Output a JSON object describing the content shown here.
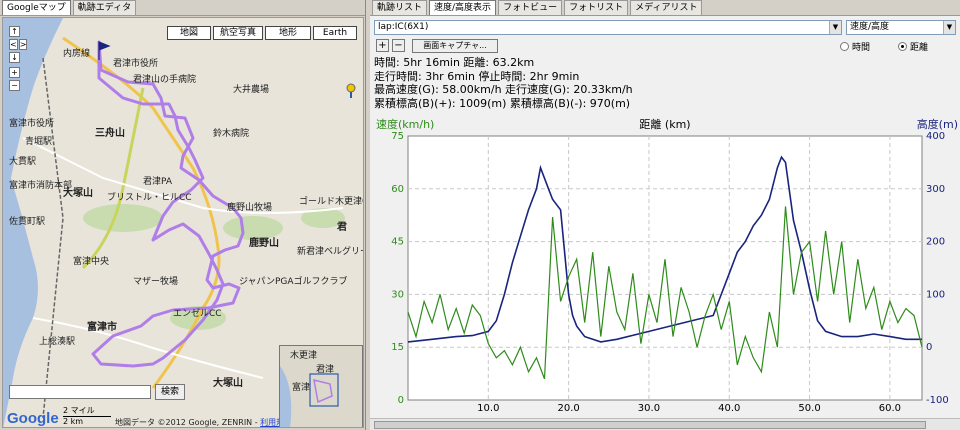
{
  "left_tabs": [
    "Googleマップ",
    "軌跡エディタ"
  ],
  "map": {
    "types": [
      "地図",
      "航空写真",
      "地形",
      "Earth"
    ],
    "labels": [
      {
        "text": "君津市役所"
      },
      {
        "text": "君津山の手病院"
      },
      {
        "text": "大井農場"
      },
      {
        "text": "鈴木病院"
      },
      {
        "text": "富津市役所"
      },
      {
        "text": "三舟山"
      },
      {
        "text": "大塚山"
      },
      {
        "text": "富津市消防本部"
      },
      {
        "text": "ブリストル・ヒルCC"
      },
      {
        "text": "君津PA"
      },
      {
        "text": "鹿野山牧場"
      },
      {
        "text": "鹿野山"
      },
      {
        "text": "ゴールド木更津CC"
      },
      {
        "text": "新君津ベルグリーンCC"
      },
      {
        "text": "マザー牧場"
      },
      {
        "text": "ジャパンPGAゴルフクラブ"
      },
      {
        "text": "エンゼルCC"
      },
      {
        "text": "富津市"
      },
      {
        "text": "上総湊駅"
      },
      {
        "text": "大塚山"
      },
      {
        "text": "内房線"
      },
      {
        "text": "佐貫町駅"
      },
      {
        "text": "大貫駅"
      },
      {
        "text": "青堀駅"
      },
      {
        "text": "富津中央"
      },
      {
        "text": "君"
      }
    ],
    "search_button": "検索",
    "scale_mi": "2 マイル",
    "scale_km": "2 km",
    "copyright": "地図データ ©2012 Google, ZENRIN",
    "terms": "利用規約",
    "logo": "Google",
    "inset_labels": [
      "木更津",
      "君津",
      "富津"
    ],
    "track_color": "#b07ee8"
  },
  "right_tabs": [
    "軌跡リスト",
    "速度/高度表示",
    "フォトビュー",
    "フォトリスト",
    "メディアリスト"
  ],
  "track_select": "lap:IC(6X1)",
  "graph_select": "速度/高度",
  "capture_button": "画面キャプチャ...",
  "plus_label": "+",
  "minus_label": "−",
  "radio_time": "時間",
  "radio_distance": "距離",
  "stats": [
    "時間: 5hr 16min  距離: 63.2km",
    "走行時間: 3hr 6min  停止時間: 2hr 9min",
    "最高速度(G): 58.00km/h  走行速度(G): 20.33km/h",
    "累積標高(B)(+): 1009(m)  累積標高(B)(-): 970(m)"
  ],
  "chart_data": {
    "type": "line",
    "title": "",
    "xlabel": "距離 (km)",
    "ylabel": "速度(km/h)",
    "y2label": "高度(m)",
    "x_range": [
      0,
      64
    ],
    "xticks": [
      "10.0",
      "20.0",
      "30.0",
      "40.0",
      "50.0",
      "60.0"
    ],
    "ylim": [
      0,
      75
    ],
    "yticks": [
      "0",
      "15",
      "30",
      "45",
      "60",
      "75"
    ],
    "y2lim": [
      -100,
      400
    ],
    "y2ticks": [
      "-100",
      "0",
      "100",
      "200",
      "300",
      "400"
    ],
    "series": [
      {
        "name": "高度",
        "axis": "right",
        "color": "#1a237e",
        "x": [
          0,
          3,
          6,
          8,
          10,
          11,
          12,
          13,
          14,
          15,
          16,
          16.5,
          17.5,
          18,
          19,
          20,
          20.5,
          21,
          22,
          24,
          26,
          30,
          34,
          38,
          40,
          41,
          42,
          43,
          44,
          45,
          46,
          46.5,
          47,
          48,
          49,
          50,
          51,
          52,
          54,
          56,
          58,
          60,
          62,
          64
        ],
        "values": [
          10,
          15,
          20,
          22,
          30,
          50,
          100,
          160,
          210,
          260,
          300,
          340,
          300,
          280,
          260,
          100,
          60,
          40,
          20,
          10,
          15,
          30,
          45,
          60,
          140,
          180,
          200,
          230,
          250,
          280,
          340,
          360,
          350,
          240,
          180,
          110,
          50,
          30,
          20,
          20,
          25,
          20,
          15,
          15
        ]
      },
      {
        "name": "速度",
        "axis": "left",
        "color": "#2e8b1a",
        "x": [
          0,
          1,
          2,
          3,
          4,
          5,
          6,
          7,
          8,
          9,
          10,
          11,
          12,
          13,
          14,
          15,
          16,
          17,
          18,
          19,
          20,
          21,
          22,
          23,
          24,
          25,
          26,
          27,
          28,
          29,
          30,
          31,
          32,
          33,
          34,
          35,
          36,
          37,
          38,
          39,
          40,
          41,
          42,
          43,
          44,
          45,
          46,
          47,
          48,
          49,
          50,
          51,
          52,
          53,
          54,
          55,
          56,
          57,
          58,
          59,
          60,
          61,
          62,
          63,
          64
        ],
        "values": [
          25,
          18,
          28,
          22,
          30,
          20,
          26,
          19,
          27,
          24,
          16,
          12,
          14,
          10,
          15,
          8,
          12,
          6,
          52,
          28,
          35,
          40,
          22,
          42,
          18,
          38,
          25,
          20,
          36,
          16,
          30,
          22,
          40,
          18,
          32,
          25,
          15,
          24,
          30,
          20,
          28,
          10,
          18,
          12,
          8,
          25,
          15,
          55,
          30,
          42,
          45,
          28,
          48,
          30,
          45,
          22,
          40,
          26,
          32,
          20,
          28,
          22,
          26,
          24,
          15
        ]
      }
    ]
  }
}
